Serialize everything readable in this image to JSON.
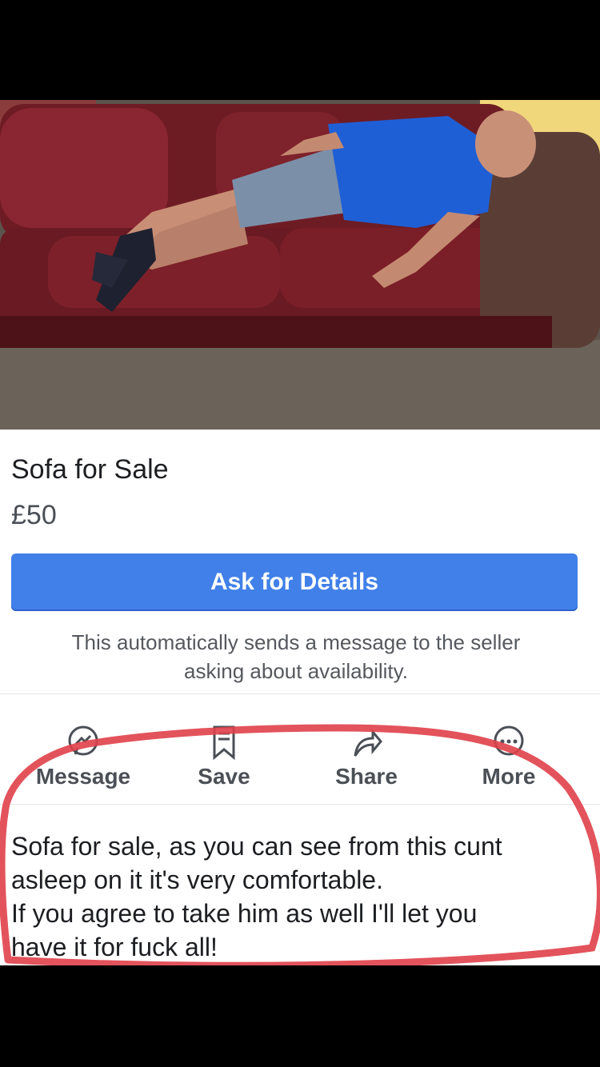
{
  "listing": {
    "title": "Sofa for Sale",
    "price": "£50",
    "ask_button": "Ask for Details",
    "note_lines": [
      "This automatically sends a message to the seller",
      "asking about availability."
    ]
  },
  "actions": [
    {
      "label": "Message",
      "icon": "messenger-icon"
    },
    {
      "label": "Save",
      "icon": "bookmark-icon"
    },
    {
      "label": "Share",
      "icon": "share-icon"
    },
    {
      "label": "More",
      "icon": "more-icon"
    }
  ],
  "description_lines": [
    "Sofa for sale, as you can see from this cunt",
    "asleep on it it's very comfortable.",
    "If you agree to take him as well I'll let you",
    "have it for fuck all!"
  ],
  "colors": {
    "ask_button": "#4080e8",
    "annotation_circle": "#e0404a",
    "sofa": "#7a1f26",
    "shirt": "#1f5fd6"
  }
}
